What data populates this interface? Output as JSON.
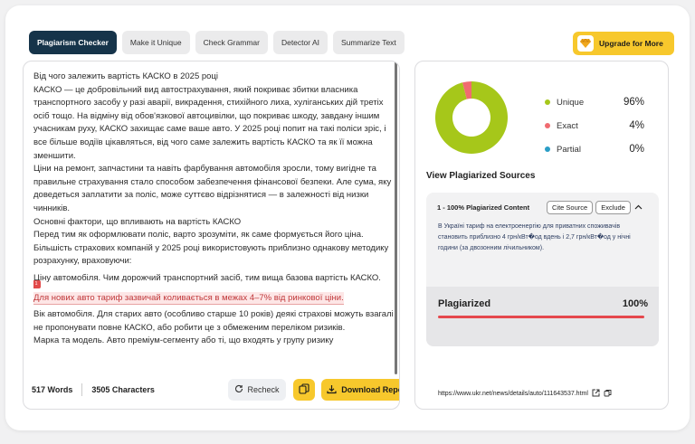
{
  "tabs": [
    {
      "label": "Plagiarism Checker",
      "active": true
    },
    {
      "label": "Make it Unique",
      "active": false
    },
    {
      "label": "Check Grammar",
      "active": false
    },
    {
      "label": "Detector AI",
      "active": false
    },
    {
      "label": "Summarize Text",
      "active": false
    }
  ],
  "upgrade": {
    "label": "Upgrade for More",
    "icon": "diamond-icon"
  },
  "editor": {
    "paragraphs": [
      "Від чого залежить вартість КАСКО в 2025 році",
      "КАСКО — це добровільний вид автострахування, який покриває збитки власника транспортного засобу у разі аварії, викрадення, стихійного лиха, хуліганських дій третіх осіб тощо. На відміну від обов'язкової автоцивілки, що покриває шкоду, завдану іншим учасникам руху, КАСКО захищає саме ваше авто. У 2025 році попит на такі поліси зріс, і все більше водіїв цікавляться, від чого саме залежить вартість КАСКО та як її можна зменшити.",
      "Ціни на ремонт, запчастини та навіть фарбування автомобіля зросли, тому вигідне та правильне страхування стало способом забезпечення фінансової безпеки. Але сума, яку доведеться заплатити за поліс, може суттєво відрізнятися — в залежності від низки чинників.",
      "Основні фактори, що впливають на вартість КАСКО",
      "Перед тим як оформлювати поліс, варто зрозуміти, як саме формується його ціна. Більшість страхових компаній у 2025 році використовують приблизно однакову методику розрахунку, враховуючи:"
    ],
    "para_before_highlight": "Ціну автомобіля. Чим дорожчий транспортний засіб, тим вища базова вартість КАСКО.",
    "highlight_text": "Для нових авто тариф зазвичай коливається в межах 4–7% від ринкової ціни.",
    "highlight_badge": "1",
    "paragraphs_after": [
      "Вік автомобіля. Для старих авто (особливо старше 10 років) деякі страхові можуть взагалі не пропонувати повне КАСКО, або робити це з обмеженим переліком ризиків.",
      "Марка та модель. Авто преміум-сегменту або ті, що входять у групу ризику"
    ],
    "word_count": "517 Words",
    "char_count": "3505 Characters",
    "recheck_label": "Recheck",
    "download_label": "Download Report"
  },
  "results": {
    "legend": [
      {
        "name": "Unique",
        "value": "96%",
        "color": "#a6c71a",
        "pct": 96
      },
      {
        "name": "Exact",
        "value": "4%",
        "color": "#f06b70",
        "pct": 4
      },
      {
        "name": "Partial",
        "value": "0%",
        "color": "#2a9dc6",
        "pct": 0
      }
    ],
    "view_sources_title": "View Plagiarized Sources",
    "source": {
      "title": "1 - 100% Plagiarized Content",
      "cite_label": "Cite Source",
      "exclude_label": "Exclude",
      "text": "В Україні тариф на електроенергію для приватних споживачів становить приблизно 4 грн/кВт�од вдень і 2,7 грн/кВт�од у нічні години (за двозонним лічильником).",
      "plag_label": "Plagiarized",
      "plag_value": "100%",
      "plag_fraction": 1.0,
      "url": "https://www.ukr.net/news/details/auto/111643537.html"
    }
  }
}
